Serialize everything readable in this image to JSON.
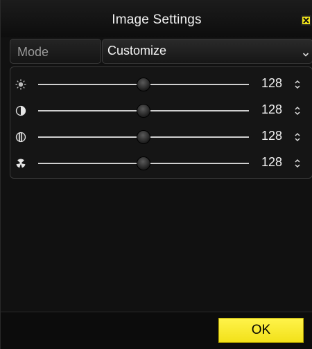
{
  "window": {
    "title": "Image Settings",
    "close_icon": "close-icon"
  },
  "mode": {
    "label": "Mode",
    "selected": "Customize",
    "chevron_icon": "chevron-down-icon"
  },
  "sliders": [
    {
      "name": "brightness",
      "icon": "brightness-icon",
      "value": "128",
      "level": 0.5
    },
    {
      "name": "contrast",
      "icon": "contrast-icon",
      "value": "128",
      "level": 0.5
    },
    {
      "name": "saturation",
      "icon": "saturation-icon",
      "value": "128",
      "level": 0.5
    },
    {
      "name": "hue",
      "icon": "hue-icon",
      "value": "128",
      "level": 0.5
    }
  ],
  "footer": {
    "ok_label": "OK"
  },
  "colors": {
    "accent": "#f2e51c",
    "background": "#111111"
  }
}
